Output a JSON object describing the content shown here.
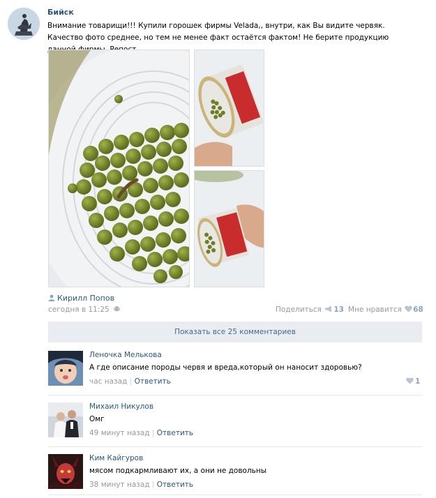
{
  "post": {
    "author": "Бийск",
    "text": "Внимание товарищи!!! Купили горошек фирмы Velada,, внутри, как Вы видите червяк. Качество фото среднее, но тем не менее факт остаётся фактом! Не берите продукцию данной фирмы. Репост",
    "signed_by": "Кирилл Попов",
    "time": "сегодня в 11:25",
    "share_label": "Поделиться",
    "share_count": "13",
    "like_label": "Мне нравится",
    "like_count": "68",
    "show_all": "Показать все 25 комментариев"
  },
  "comments": [
    {
      "name": "Леночка Мелькова",
      "text": "А где описание породы червя и вреда,который он наносит здоровью?",
      "time": "час назад",
      "reply": "Ответить",
      "likes": "1"
    },
    {
      "name": "Михаил Никулов",
      "text": "Омг",
      "time": "49 минут назад",
      "reply": "Ответить"
    },
    {
      "name": "Ким Кайгуров",
      "text": "мясом подкармливают их, а они не довольны",
      "time": "38 минут назад",
      "reply": "Ответить"
    }
  ],
  "colors": {
    "link": "#2b587a",
    "accent": "#45688e",
    "bar": "#e9edf1"
  }
}
